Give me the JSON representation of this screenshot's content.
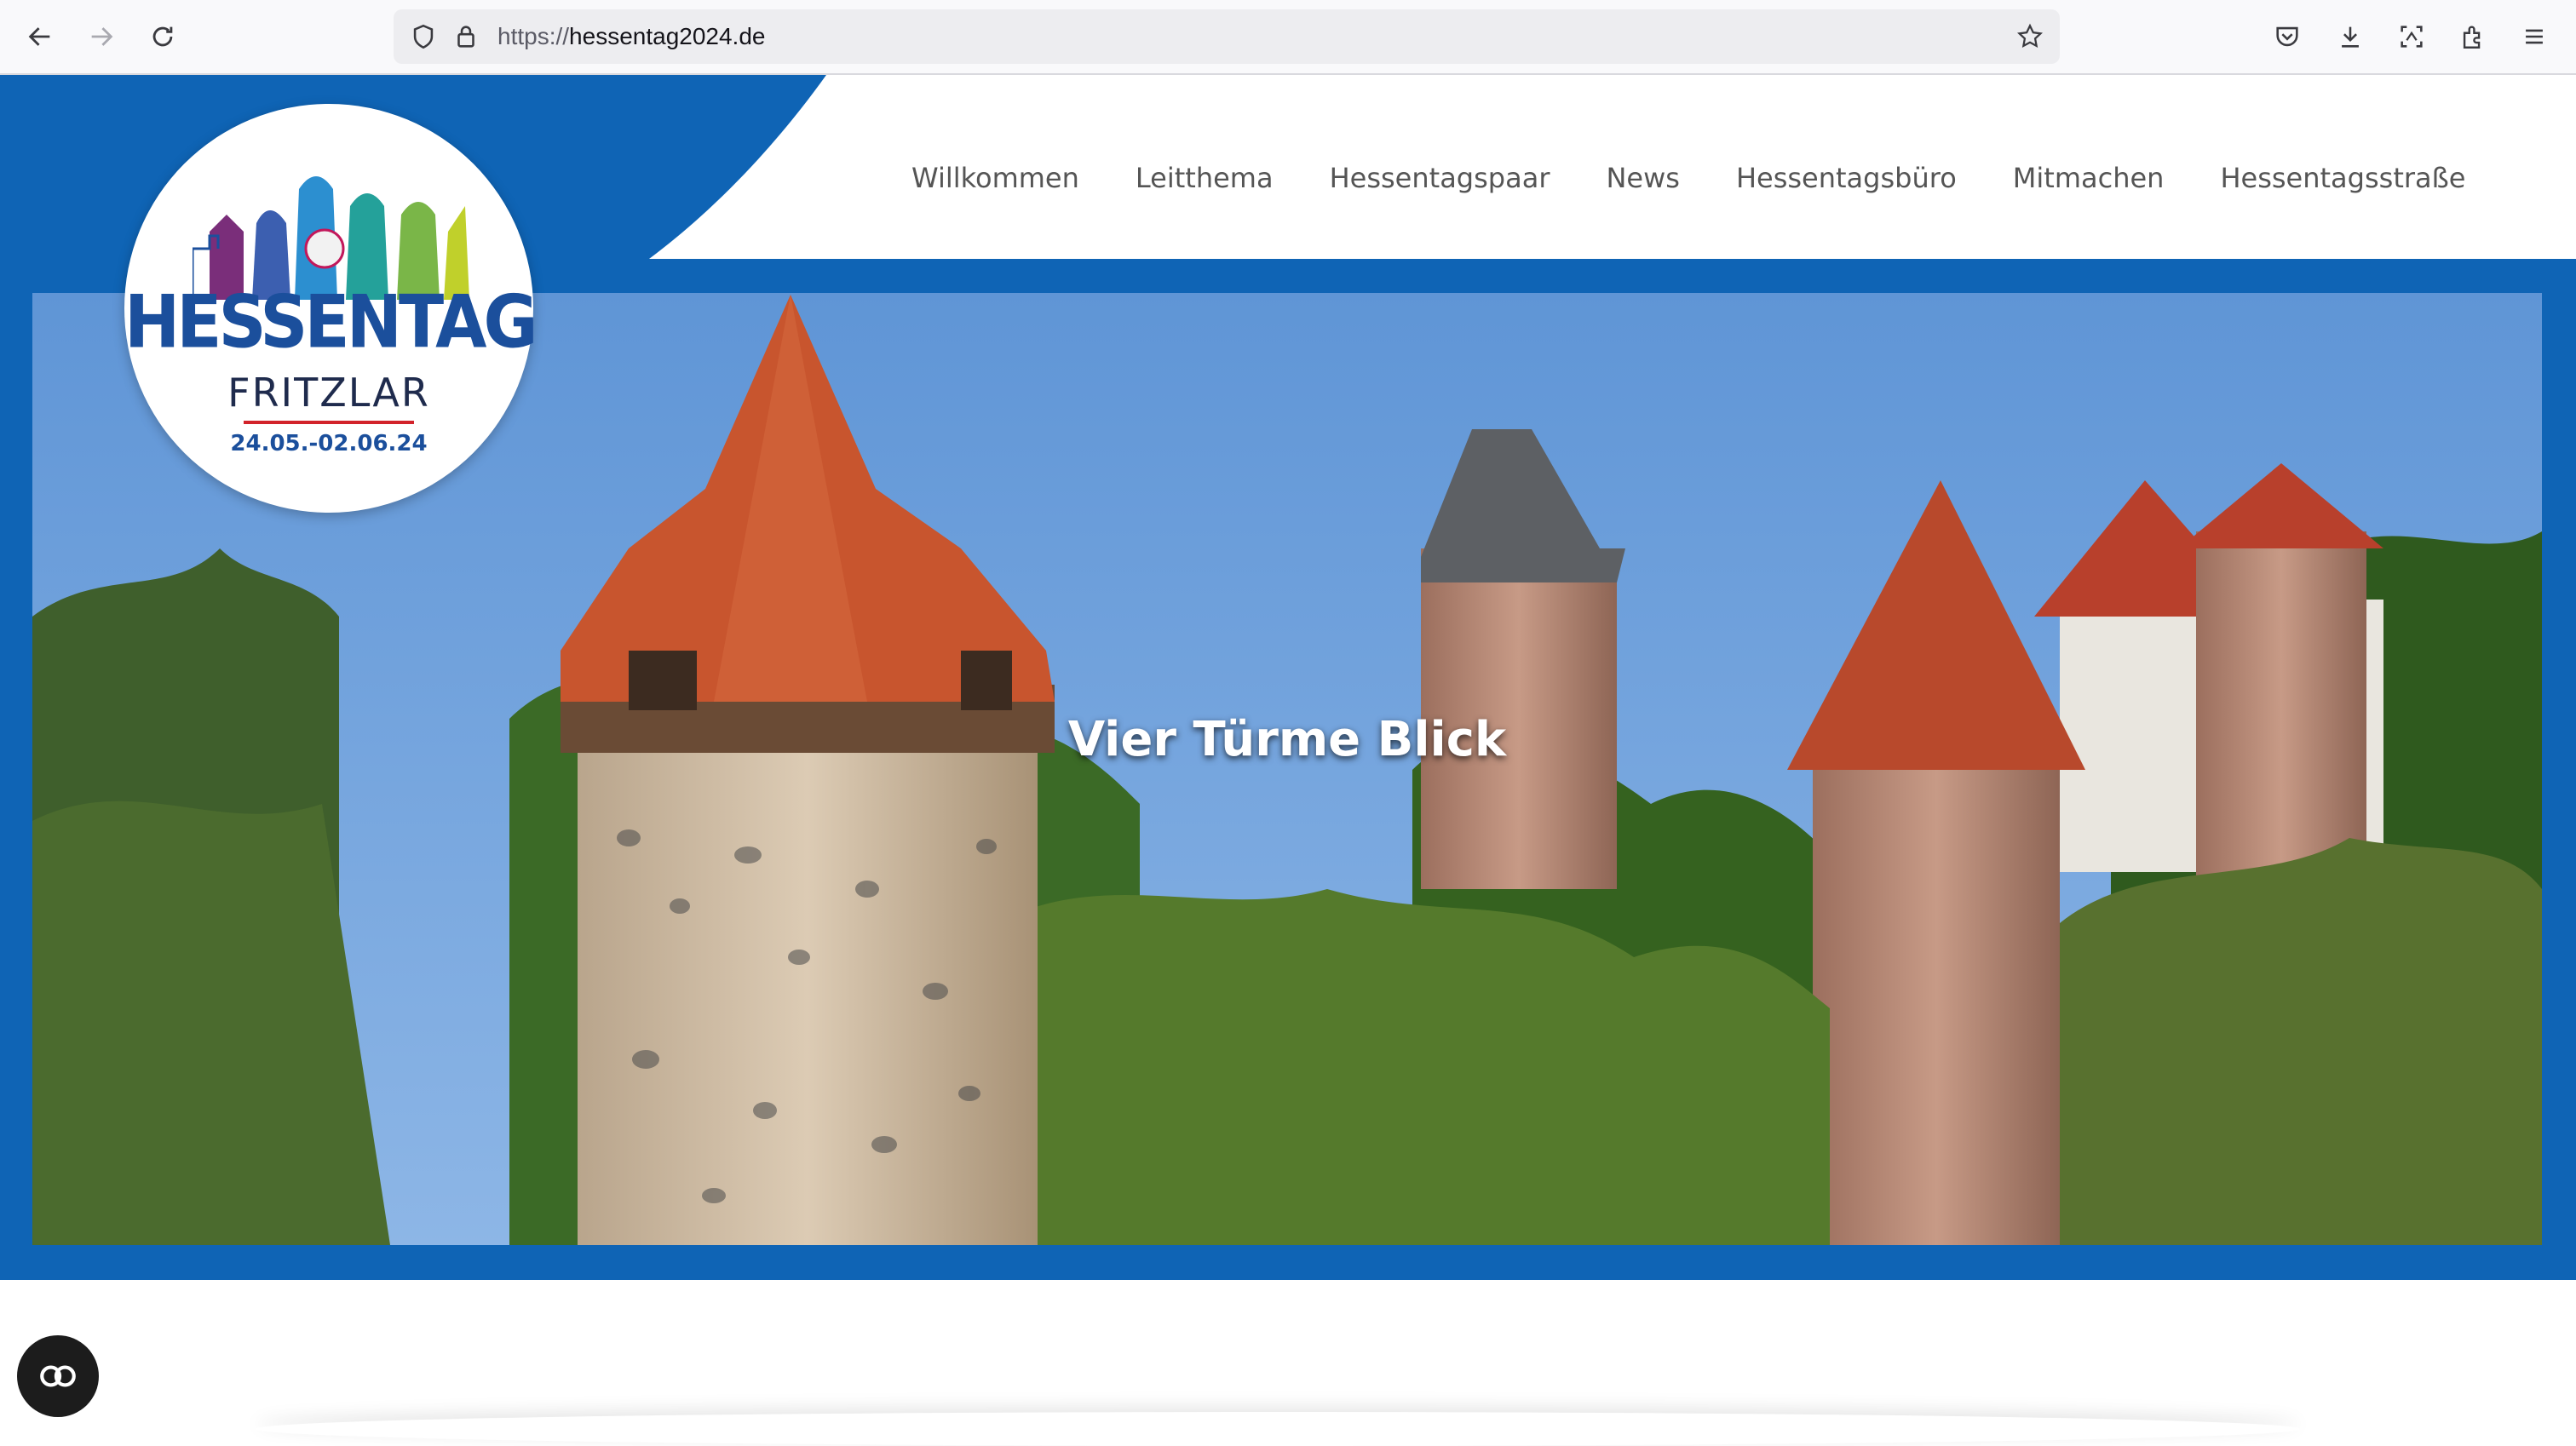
{
  "browser": {
    "url_scheme": "https://",
    "url_host": "hessentag2024.de",
    "icons": [
      "back-icon",
      "forward-icon",
      "reload-icon",
      "shield-icon",
      "lock-icon",
      "bookmark-star-icon",
      "pocket-icon",
      "download-icon",
      "screenshot-icon",
      "extensions-icon",
      "menu-icon"
    ]
  },
  "logo": {
    "title": "HESSENTAG",
    "city": "FRITZLAR",
    "dates": "24.05.-02.06.24"
  },
  "nav": {
    "items": [
      "Willkommen",
      "Leitthema",
      "Hessentagspaar",
      "News",
      "Hessentagsbüro",
      "Mitmachen",
      "Hessentagsstraße"
    ]
  },
  "hero": {
    "title": "Vier Türme Blick"
  },
  "colors": {
    "brand_blue": "#0f64b5",
    "roof_red": "#c8552e",
    "logo_blue": "#1b4f9c"
  }
}
